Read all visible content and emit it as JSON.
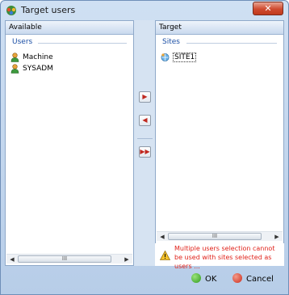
{
  "window": {
    "title": "Target users",
    "close_glyph": "✕"
  },
  "available": {
    "header": "Available",
    "group_title": "Users",
    "items": [
      {
        "label": "Machine",
        "icon": "user-icon"
      },
      {
        "label": "SYSADM",
        "icon": "user-icon"
      }
    ],
    "scroll_thumb": "III"
  },
  "target": {
    "header": "Target",
    "group_title": "Sites",
    "items": [
      {
        "label": "SITE1",
        "icon": "site-icon"
      }
    ],
    "scroll_thumb": "III"
  },
  "transfer_buttons": {
    "add": "▶",
    "remove": "◀",
    "add_all": "▶▶"
  },
  "warning": {
    "message": "Multiple users selection cannot be used with sites selected as users ..."
  },
  "buttons": {
    "ok": "OK",
    "cancel": "Cancel"
  },
  "colors": {
    "warning_text": "#e0221a",
    "group_title": "#1b4fa5",
    "close_button": "#c13a1c"
  }
}
